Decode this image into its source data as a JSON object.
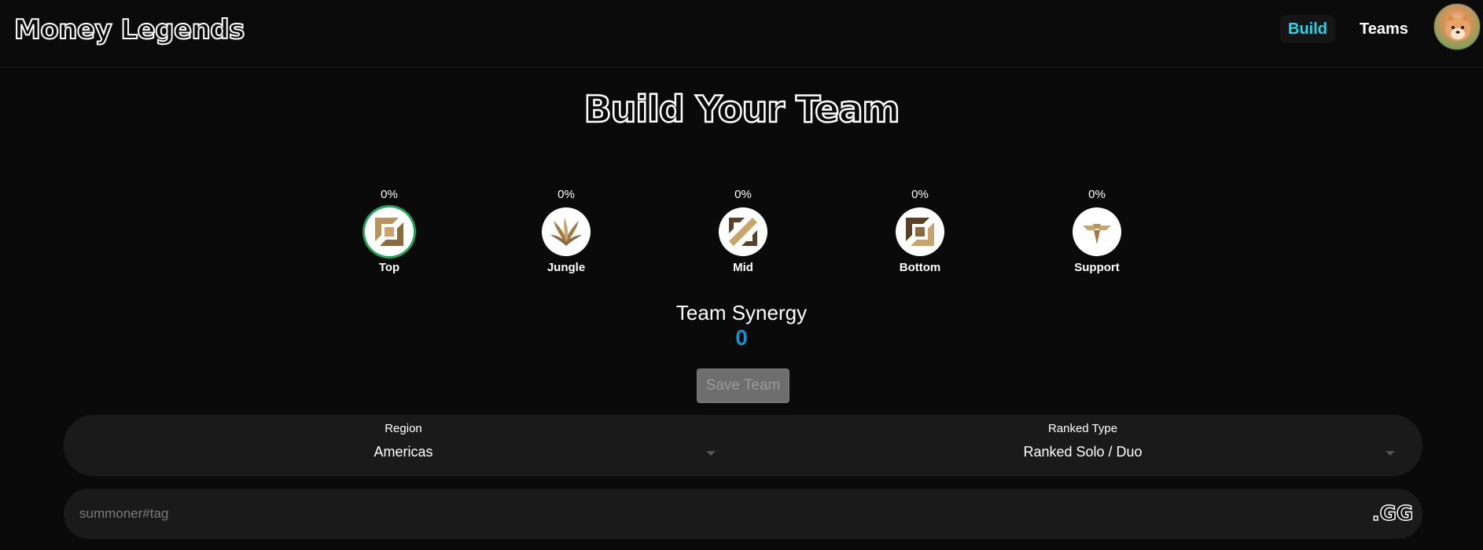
{
  "app": {
    "brand": "Money Legends"
  },
  "nav": {
    "build": "Build",
    "teams": "Teams"
  },
  "page": {
    "title": "Build Your Team"
  },
  "roles": [
    {
      "label": "Top",
      "percent": "0%",
      "selected": true
    },
    {
      "label": "Jungle",
      "percent": "0%",
      "selected": false
    },
    {
      "label": "Mid",
      "percent": "0%",
      "selected": false
    },
    {
      "label": "Bottom",
      "percent": "0%",
      "selected": false
    },
    {
      "label": "Support",
      "percent": "0%",
      "selected": false
    }
  ],
  "synergy": {
    "label": "Team Synergy",
    "value": "0"
  },
  "save_button": {
    "label": "Save Team",
    "disabled": true
  },
  "filters": {
    "region": {
      "label": "Region",
      "value": "Americas"
    },
    "ranked_type": {
      "label": "Ranked Type",
      "value": "Ranked Solo / Duo"
    }
  },
  "search": {
    "placeholder": "summoner#tag",
    "value": "",
    "button_label": ".GG"
  },
  "colors": {
    "accent": "#2ad4e6",
    "synergy": "#1a90c8",
    "selected_ring": "#1fa65a",
    "background": "#0a0a0a",
    "panel": "#1a1a1a",
    "role_gold": "#b8935a"
  }
}
